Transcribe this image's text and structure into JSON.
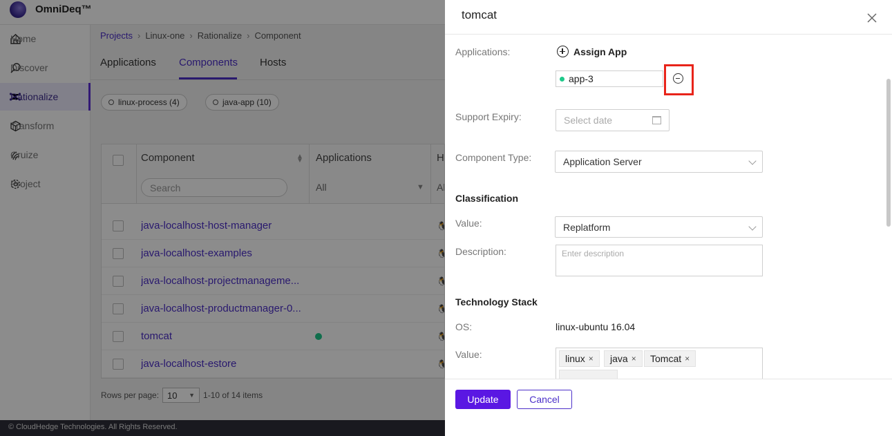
{
  "app": {
    "brand": "OmniDeq™",
    "footer": "© CloudHedge Technologies. All Rights Reserved."
  },
  "sidebar": {
    "items": [
      {
        "label": "Home",
        "icon": "home-icon"
      },
      {
        "label": "Discover",
        "icon": "search-globe-icon"
      },
      {
        "label": "Rationalize",
        "icon": "network-icon",
        "active": true
      },
      {
        "label": "Transform",
        "icon": "cube-icon"
      },
      {
        "label": "Cruize",
        "icon": "fingerprint-icon"
      },
      {
        "label": "Project",
        "icon": "gear-icon"
      }
    ]
  },
  "breadcrumb": [
    "Projects",
    "Linux-one",
    "Rationalize",
    "Component"
  ],
  "tabs": [
    "Applications",
    "Components",
    "Hosts"
  ],
  "active_tab": "Components",
  "filters": [
    {
      "label": "linux-process (4)"
    },
    {
      "label": "java-app (10)"
    }
  ],
  "grid": {
    "headers": [
      "Component",
      "Applications",
      "Ho"
    ],
    "search_placeholder": "Search",
    "app_filter": "All",
    "host_filter": "Al",
    "rows": [
      {
        "name": "java-localhost-host-manager",
        "has_app": false
      },
      {
        "name": "java-localhost-examples",
        "has_app": false
      },
      {
        "name": "java-localhost-projectmanageme...",
        "has_app": false
      },
      {
        "name": "java-localhost-productmanager-0...",
        "has_app": false
      },
      {
        "name": "tomcat",
        "has_app": true
      },
      {
        "name": "java-localhost-estore",
        "has_app": false
      }
    ]
  },
  "pager": {
    "label": "Rows per page:",
    "size": "10",
    "range": "1-10 of 14 items"
  },
  "drawer": {
    "title": "tomcat",
    "applications_label": "Applications:",
    "assign_label": "Assign App",
    "assigned_app": "app-3",
    "support_expiry_label": "Support Expiry:",
    "date_placeholder": "Select date",
    "component_type_label": "Component Type:",
    "component_type": "Application Server",
    "classification_title": "Classification",
    "value_label": "Value:",
    "classification_value": "Replatform",
    "description_label": "Description:",
    "description_placeholder": "Enter description",
    "tech_stack_title": "Technology Stack",
    "os_label": "OS:",
    "os_value": "linux-ubuntu 16.04",
    "tech_value_label": "Value:",
    "tech_tags": [
      "linux",
      "java",
      "Tomcat"
    ],
    "update_label": "Update",
    "cancel_label": "Cancel"
  },
  "colors": {
    "accent": "#5a17e3",
    "link": "#4c2fc9",
    "highlight": "#e8241a",
    "status_green": "#1ec98a"
  }
}
